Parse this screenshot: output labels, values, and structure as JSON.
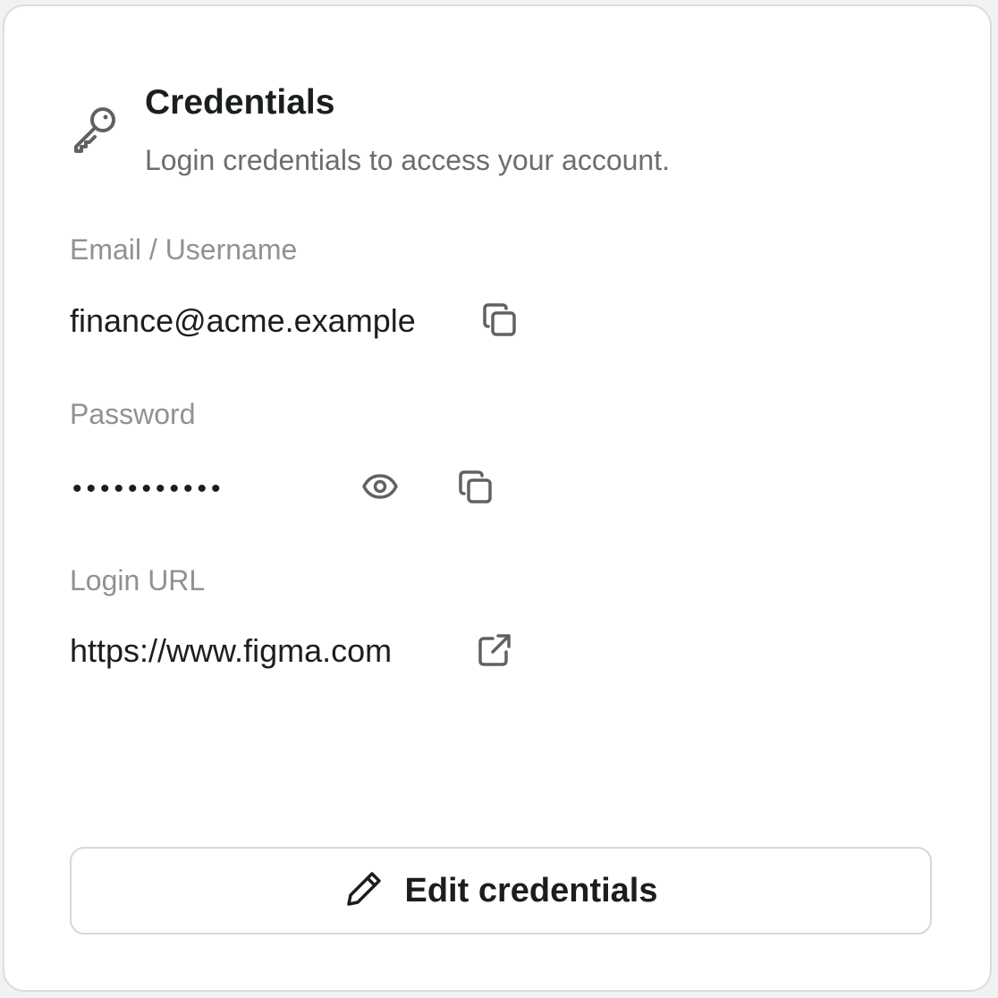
{
  "card": {
    "title": "Credentials",
    "subtitle": "Login credentials to access your account.",
    "header_icon": "key-icon"
  },
  "fields": {
    "email": {
      "label": "Email / Username",
      "value": "finance@acme.example",
      "action_icon": "copy-icon"
    },
    "password": {
      "label": "Password",
      "masked_value": "•••••••••••",
      "action_icons": [
        "eye-icon",
        "copy-icon"
      ]
    },
    "login_url": {
      "label": "Login URL",
      "value": "https://www.figma.com",
      "action_icon": "external-link-icon"
    }
  },
  "edit_button": {
    "label": "Edit credentials",
    "icon": "pencil-icon"
  },
  "colors": {
    "text_primary": "#1b1f1c",
    "text_secondary": "#6b6f6c",
    "text_label": "#8f9390",
    "icon": "#5f6360",
    "border": "#d6d8d6"
  }
}
